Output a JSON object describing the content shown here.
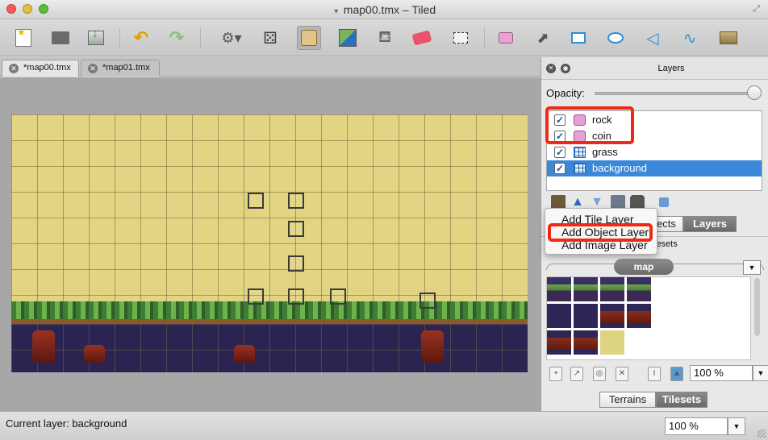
{
  "window": {
    "title": "map00.tmx – Tiled"
  },
  "toolbar": {
    "tools": [
      {
        "name": "new-map-icon"
      },
      {
        "name": "open-file-icon"
      },
      {
        "name": "save-file-icon"
      },
      {
        "name": "undo-icon"
      },
      {
        "name": "redo-icon"
      },
      {
        "name": "random-mode-icon"
      },
      {
        "name": "dice-icon"
      },
      {
        "name": "stamp-brush-icon"
      },
      {
        "name": "terrain-brush-icon"
      },
      {
        "name": "bucket-fill-icon"
      },
      {
        "name": "eraser-icon"
      },
      {
        "name": "rectangular-select-icon"
      },
      {
        "name": "select-objects-icon"
      },
      {
        "name": "edit-polygons-icon"
      },
      {
        "name": "insert-rectangle-icon"
      },
      {
        "name": "insert-ellipse-icon"
      },
      {
        "name": "insert-polygon-icon"
      },
      {
        "name": "insert-polyline-icon"
      },
      {
        "name": "insert-tile-icon"
      }
    ],
    "active_tool": "stamp-brush"
  },
  "tabs": [
    {
      "label": "*map00.tmx",
      "active": true
    },
    {
      "label": "*map01.tmx",
      "active": false
    }
  ],
  "layers_panel": {
    "title": "Layers",
    "opacity_label": "Opacity:",
    "opacity_value": 1.0,
    "layers": [
      {
        "name": "rock",
        "type": "object",
        "visible": true,
        "selected": false
      },
      {
        "name": "coin",
        "type": "object",
        "visible": true,
        "selected": false
      },
      {
        "name": "grass",
        "type": "tile",
        "visible": true,
        "selected": false
      },
      {
        "name": "background",
        "type": "tile",
        "visible": true,
        "selected": true
      }
    ],
    "bottom_tabs": {
      "objects_partial": "ects",
      "layers": "Layers"
    },
    "tilesets_partial": "lesets"
  },
  "new_layer_menu": {
    "items": [
      "Add Tile Layer",
      "Add Object Layer",
      "Add Image Layer"
    ],
    "highlighted": "Add Object Layer"
  },
  "tilesets_panel": {
    "tileset_name": "map",
    "zoom": "100 %",
    "tabs": {
      "terrains": "Terrains",
      "tilesets": "Tilesets"
    },
    "active_tab": "Tilesets"
  },
  "statusbar": {
    "current_layer": "Current layer: background",
    "zoom": "100 %"
  },
  "colors": {
    "selection": "#3b87d9",
    "highlight_box": "#ee2a16",
    "map_sky": "#e2d483",
    "map_ground": "#2c2450"
  }
}
